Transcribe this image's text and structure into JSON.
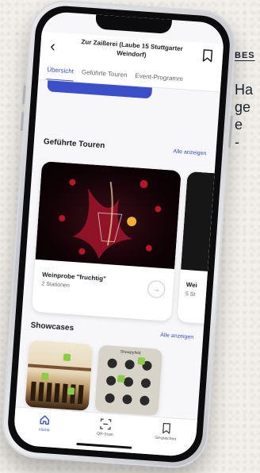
{
  "side": {
    "kicker": "BES",
    "lines": [
      "Ha",
      "ge",
      "e",
      "-"
    ]
  },
  "app": {
    "title": "Zur Zaißerei (Laube 15 Stuttgarter Weindorf)",
    "tabs": [
      {
        "label": "Übersicht",
        "active": true
      },
      {
        "label": "Geführte Touren",
        "active": false
      },
      {
        "label": "Event-Programm",
        "active": false
      }
    ]
  },
  "tours_section": {
    "title": "Geführte Touren",
    "see_all": "Alle anzeigen",
    "cards": [
      {
        "name": "Weinprobe \"fruchtig\"",
        "stations": "2 Stationen"
      },
      {
        "name": "Wei",
        "stations": "5 St"
      }
    ]
  },
  "showcases_section": {
    "title": "Showcases",
    "see_all": "Alle anzeigen",
    "cards": [
      {
        "label": ""
      },
      {
        "label": "Showpyfeld"
      }
    ]
  },
  "bottom_nav": {
    "items": [
      {
        "label": "Home",
        "icon": "home-icon",
        "active": true
      },
      {
        "label": "QR-Scan",
        "icon": "qr-scan-icon",
        "active": false
      },
      {
        "label": "Gespeichert",
        "icon": "bookmark-icon",
        "active": false
      }
    ]
  },
  "colors": {
    "accent": "#3a4fc8",
    "green": "#8ecb45"
  }
}
